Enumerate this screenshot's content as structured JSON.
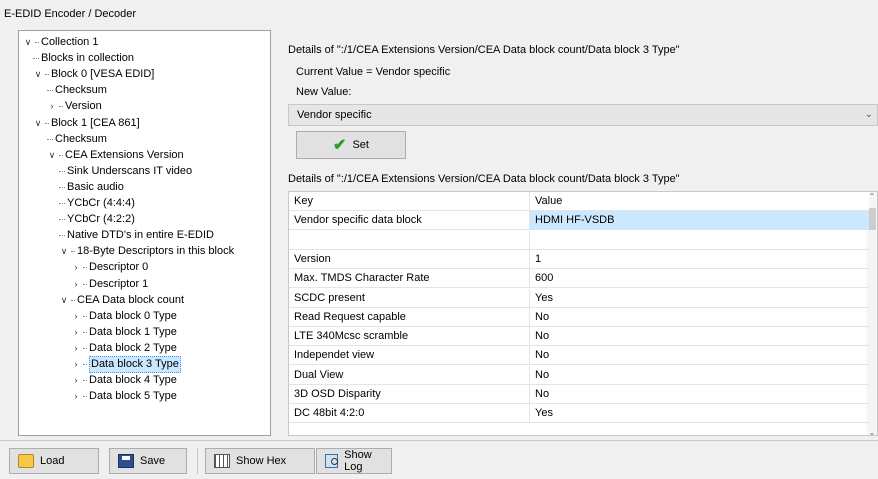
{
  "window": {
    "title": "E-EDID Encoder / Decoder"
  },
  "tree": {
    "items": [
      {
        "label": "Collection 1",
        "level": 0,
        "expander": "open"
      },
      {
        "label": "Blocks in collection",
        "level": 1,
        "expander": "leaf"
      },
      {
        "label": "Block 0 [VESA EDID]",
        "level": 1,
        "expander": "open"
      },
      {
        "label": "Checksum",
        "level": 2,
        "expander": "leaf"
      },
      {
        "label": "Version",
        "level": 2,
        "expander": "closed"
      },
      {
        "label": "Block 1 [CEA 861]",
        "level": 1,
        "expander": "open"
      },
      {
        "label": "Checksum",
        "level": 2,
        "expander": "leaf"
      },
      {
        "label": "CEA Extensions Version",
        "level": 2,
        "expander": "open"
      },
      {
        "label": "Sink Underscans IT video",
        "level": 3,
        "expander": "leaf"
      },
      {
        "label": "Basic audio",
        "level": 3,
        "expander": "leaf"
      },
      {
        "label": "YCbCr (4:4:4)",
        "level": 3,
        "expander": "leaf"
      },
      {
        "label": "YCbCr (4:2:2)",
        "level": 3,
        "expander": "leaf"
      },
      {
        "label": "Native DTD's in entire E-EDID",
        "level": 3,
        "expander": "leaf"
      },
      {
        "label": "18-Byte Descriptors in this block",
        "level": 3,
        "expander": "open"
      },
      {
        "label": "Descriptor 0",
        "level": 4,
        "expander": "closed"
      },
      {
        "label": "Descriptor 1",
        "level": 4,
        "expander": "closed"
      },
      {
        "label": "CEA Data block count",
        "level": 3,
        "expander": "open"
      },
      {
        "label": "Data block 0 Type",
        "level": 4,
        "expander": "closed"
      },
      {
        "label": "Data block 1 Type",
        "level": 4,
        "expander": "closed"
      },
      {
        "label": "Data block 2 Type",
        "level": 4,
        "expander": "closed"
      },
      {
        "label": "Data block 3 Type",
        "level": 4,
        "expander": "closed",
        "selected": true
      },
      {
        "label": "Data block 4 Type",
        "level": 4,
        "expander": "closed"
      },
      {
        "label": "Data block 5 Type",
        "level": 4,
        "expander": "closed"
      }
    ]
  },
  "details": {
    "path_label": "Details of \":/1/CEA Extensions Version/CEA Data block count/Data block 3 Type\"",
    "current_value": "Current Value = Vendor specific",
    "new_value_label": "New Value:",
    "new_value_selected": "Vendor specific",
    "set_button": "Set",
    "table_title": "Details of \":/1/CEA Extensions Version/CEA Data block count/Data block 3 Type\""
  },
  "table": {
    "columns": [
      "Key",
      "Value"
    ],
    "rows": [
      {
        "key": "Vendor specific data block",
        "value": "HDMI HF-VSDB",
        "selected": true
      },
      {
        "key": "",
        "value": ""
      },
      {
        "key": "Version",
        "value": "1"
      },
      {
        "key": "Max. TMDS Character Rate",
        "value": "600"
      },
      {
        "key": "SCDC present",
        "value": "Yes"
      },
      {
        "key": "Read Request capable",
        "value": "No"
      },
      {
        "key": "LTE 340Mcsc scramble",
        "value": "No"
      },
      {
        "key": "Independet view",
        "value": "No"
      },
      {
        "key": "Dual View",
        "value": "No"
      },
      {
        "key": "3D OSD Disparity",
        "value": "No"
      },
      {
        "key": "DC 48bit 4:2:0",
        "value": "Yes"
      }
    ]
  },
  "toolbar": {
    "load": "Load",
    "save": "Save",
    "show_hex": "Show Hex",
    "show_log": "Show Log"
  },
  "colors": {
    "selection": "#cce8ff",
    "accent_check": "#2e9a2e"
  },
  "icons": [
    "folder-icon",
    "floppy-icon",
    "hex-grid-icon",
    "log-icon",
    "checkmark-icon",
    "chevron-down-icon"
  ]
}
